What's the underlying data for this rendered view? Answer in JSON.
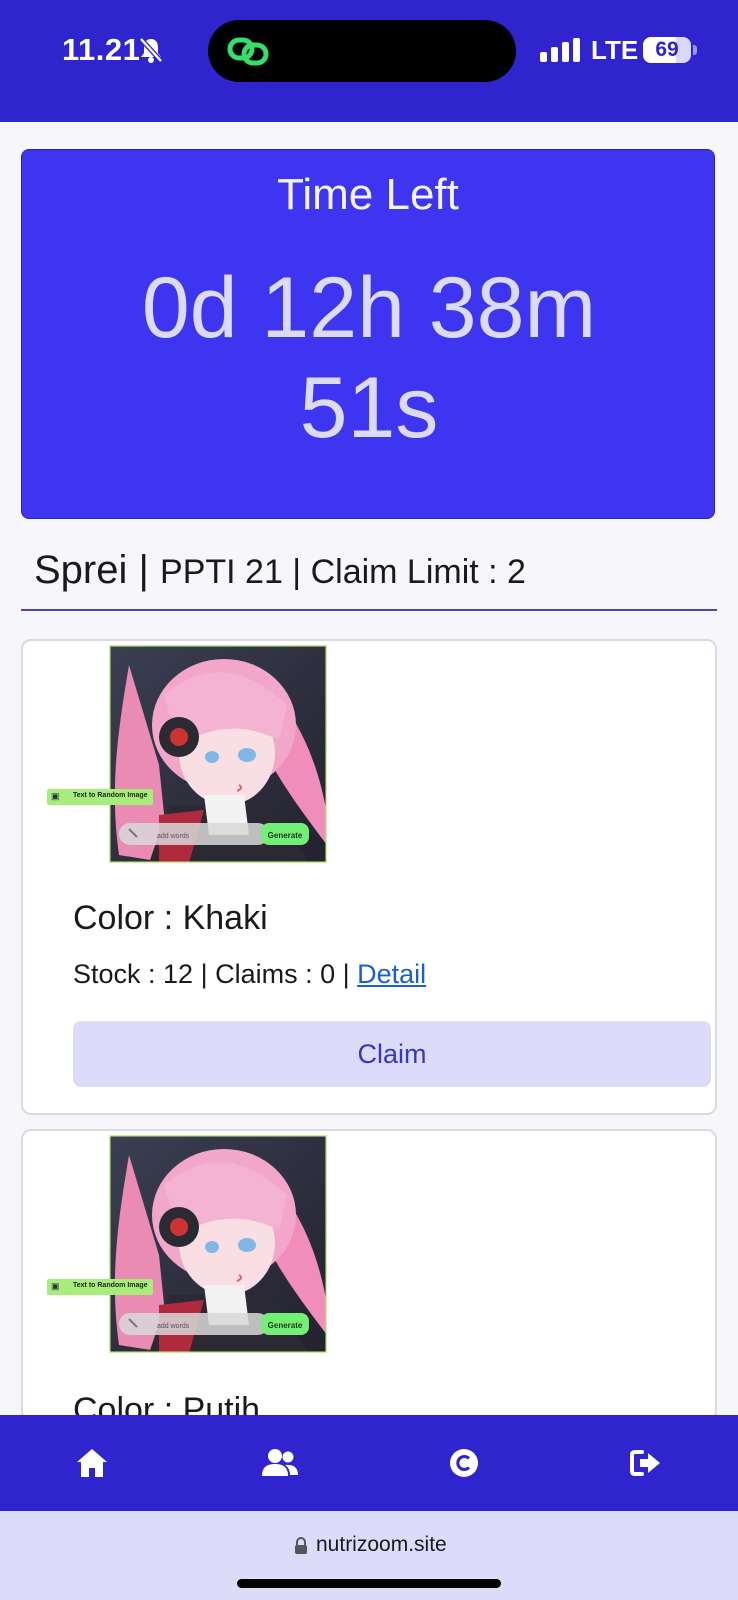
{
  "status_bar": {
    "time": "11.21",
    "network": "LTE",
    "battery": "69",
    "battery_level": 0.69,
    "icons": [
      "bell-muted-icon",
      "link-app-icon",
      "signal-icon",
      "battery-icon"
    ]
  },
  "timer": {
    "label": "Time Left",
    "value": "0d 12h 38m 51s"
  },
  "section": {
    "name": "Sprei",
    "sep1": " | ",
    "group": "PPTI 21",
    "sep2": " | ",
    "limit": "Claim Limit : 2"
  },
  "products": [
    {
      "image_badge": "Text to Random Image",
      "image_input": "add words",
      "image_button": "Generate",
      "color_label": "Color : Khaki",
      "stock_text": "Stock : 12 | Claims : 0 | ",
      "detail_link": "Detail",
      "claim_label": "Claim"
    },
    {
      "image_badge": "Text to Random Image",
      "image_input": "add words",
      "image_button": "Generate",
      "color_label": "Color : Putih"
    }
  ],
  "bottom_nav": {
    "items": [
      "home-icon",
      "users-icon",
      "copyright-icon",
      "logout-icon"
    ]
  },
  "browser": {
    "url": "nutrizoom.site"
  },
  "colors": {
    "brand": "#2f24cd",
    "timer_bg": "#3d35ef",
    "claim_bg": "#dcdcfa",
    "link": "#1a5fd0"
  }
}
